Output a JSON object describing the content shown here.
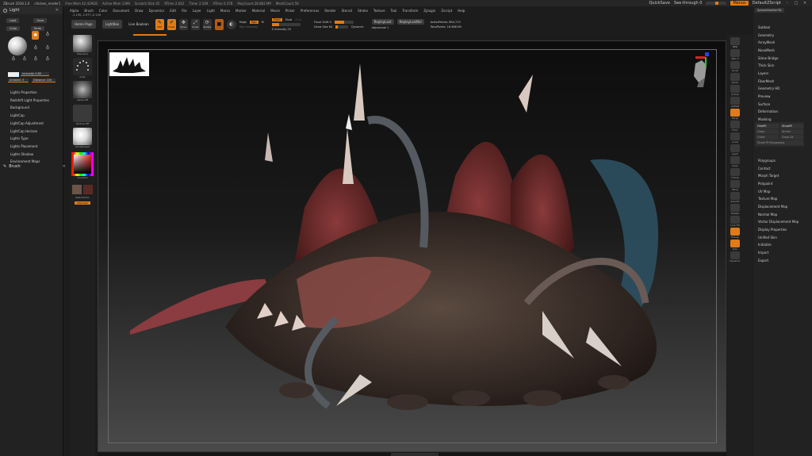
{
  "titlebar": {
    "app": "ZBrush 2018.1.0",
    "file": "chicken_render1",
    "stats": [
      "Free Mem 42.429GB",
      "Active Mem 1399",
      "Scratch Disk 45",
      "RTime 2.642",
      "Timer 2.549",
      "ATime 0.378",
      "PolyCount 28.862 MP",
      "MeshCount 59"
    ],
    "quicksave": "QuickSave",
    "seethrough": "See-through  0",
    "menus_btn": "Menus",
    "default_script": "DefaultZScript"
  },
  "menubar": [
    "Alpha",
    "Brush",
    "Color",
    "Document",
    "Draw",
    "Dynamics",
    "Edit",
    "File",
    "Layer",
    "Light",
    "Macro",
    "Marker",
    "Material",
    "Movie",
    "Picker",
    "Preferences",
    "Render",
    "Stencil",
    "Stroke",
    "Texture",
    "Tool",
    "Transform",
    "Zplugin",
    "Zscript",
    "Help"
  ],
  "coords": "-1.195,-2.977,-0.149",
  "toolbar": {
    "home": "Home Page",
    "lightbox": "LightBox",
    "live_boolean": "Live Boolean",
    "edit": "Edit",
    "draw": "Draw",
    "move": "Move",
    "scale": "Scale",
    "rotate": "Rotate",
    "mrgb": "Mrgb",
    "rgb": "Rgb",
    "m": "M",
    "zadd": "Zadd",
    "zsub": "Zsub",
    "zcut": "Zcut",
    "rgb_intensity": "Rgb Intensity",
    "z_intensity": "Z Intensity 25",
    "focal_shift": "Focal Shift 0",
    "draw_size": "Draw Size 64",
    "dynamic": "Dynamic",
    "replay_last": "ReplayLast",
    "replay_last_rel": "ReplayLastRel",
    "active_points": "ActivePoints: 894,713",
    "adjust_last": "AdjustLast 1",
    "total_points": "TotalPoints: 16.988 Mil"
  },
  "light_panel": {
    "title": "Light",
    "load": "Load",
    "save": "Save",
    "undo": "Undo",
    "redo": "Redo",
    "intensity": "Intensity 0.85",
    "ambient": "Ambient 3",
    "distance": "Distance 100",
    "items": [
      "Lights Properties",
      "Redshift Light Properties",
      "Background",
      "LightCap",
      "LightCap Adjustment",
      "LightCap Horizon",
      "Lights Type",
      "Lights Placement",
      "Lights Shadow",
      "Environment Maps"
    ],
    "brush": "Brush"
  },
  "shelf": {
    "standard": "Standard",
    "dots": "Dots",
    "alpha_off": "Alpha Off",
    "texture_off": "Texture Off",
    "matcap": "SkinShade4",
    "gradient": "Gradient",
    "switch_color": "SwitchColor",
    "alternate": "Alternate"
  },
  "right_icons": [
    "BPR",
    "SPix 3",
    "Scroll",
    "Zoom",
    "Actual",
    "AAHalf",
    "Persp",
    "Floor",
    "Local",
    "Lsym",
    "Gxyz",
    "Frame",
    "Move",
    "ZoomD",
    "Rotate",
    "Line Fill",
    "Transp",
    "Solo",
    "Dynamic"
  ],
  "right_panel": {
    "subtool_label": "SphereFeather3D",
    "items": [
      "Subtool",
      "Geometry",
      "ArrayMesh",
      "NanoMesh",
      "Slime Bridge",
      "Thick Skin",
      "Layers",
      "FiberMesh",
      "Geometry HD",
      "Preview",
      "Surface",
      "Deformation",
      "Masking",
      "Visibility"
    ],
    "visibility": {
      "hide_pt": "HidePt",
      "show_pt": "ShowPt",
      "grow": "Grow",
      "shrink": "Shrink",
      "outer": "Outer",
      "grow_all": "Grow All",
      "show_pt_polygroup": "Show Pt Polygroups"
    },
    "items2": [
      "Polygroups",
      "Contact",
      "Morph Target",
      "Polypaint",
      "UV Map",
      "Texture Map",
      "Displacement Map",
      "Normal Map",
      "Vector Displacement Map",
      "Display Properties",
      "Unified Skin",
      "Initialize",
      "Import",
      "Export"
    ]
  },
  "colors": {
    "accent": "#e07b18",
    "panel": "#222222",
    "button": "#3a3a3a"
  }
}
